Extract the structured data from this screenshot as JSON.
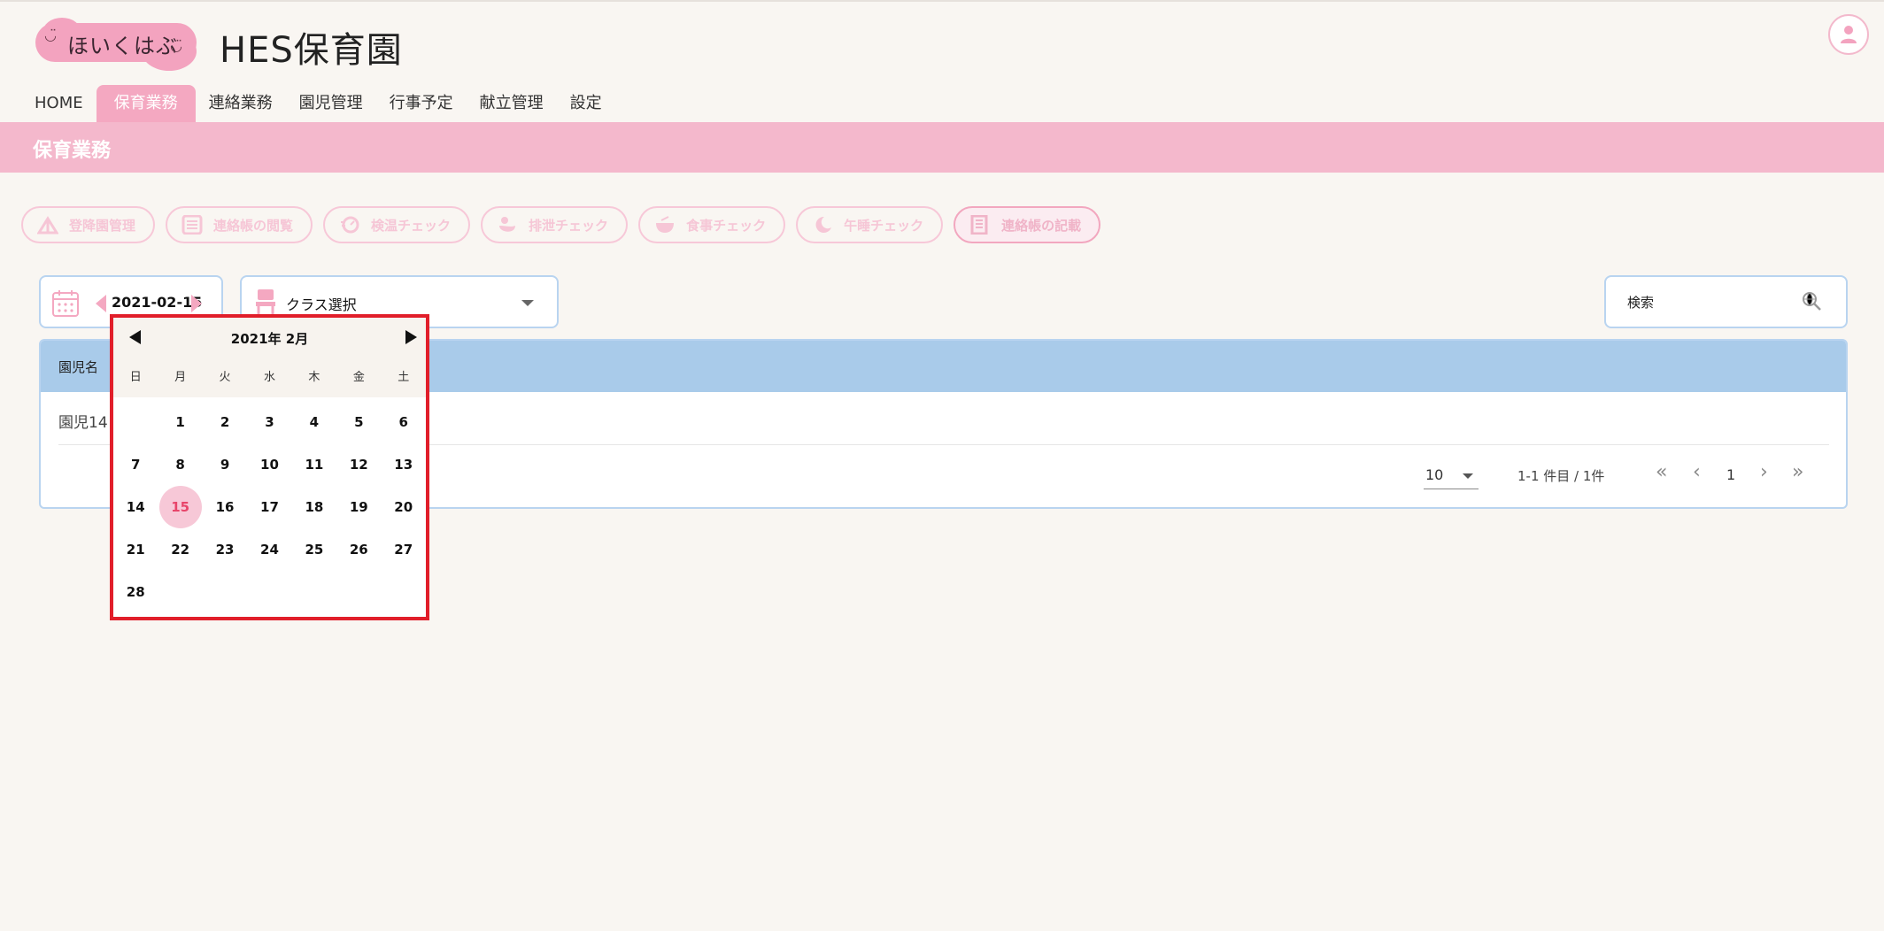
{
  "logo": {
    "text": "ほいくはぶ",
    "smile_left": "◡̈",
    "smile_right": "◡̈"
  },
  "site_title": "HES保育園",
  "nav": [
    {
      "label": "HOME",
      "active": false
    },
    {
      "label": "保育業務",
      "active": true
    },
    {
      "label": "連絡業務",
      "active": false
    },
    {
      "label": "園児管理",
      "active": false
    },
    {
      "label": "行事予定",
      "active": false
    },
    {
      "label": "献立管理",
      "active": false
    },
    {
      "label": "設定",
      "active": false
    }
  ],
  "section_title": "保育業務",
  "actions": [
    {
      "label": "登降園管理",
      "icon": "gate-icon"
    },
    {
      "label": "連絡帳の閲覧",
      "icon": "list-icon"
    },
    {
      "label": "検温チェック",
      "icon": "thermometer-icon"
    },
    {
      "label": "排泄チェック",
      "icon": "duck-icon"
    },
    {
      "label": "食事チェック",
      "icon": "bowl-icon"
    },
    {
      "label": "午睡チェック",
      "icon": "moon-icon"
    },
    {
      "label": "連絡帳の記載",
      "icon": "notebook-icon"
    }
  ],
  "filters": {
    "date": "2021-02-15",
    "class_placeholder": "クラス選択",
    "search_placeholder": "検索"
  },
  "table": {
    "header": "園児名",
    "rows": [
      "園児14"
    ]
  },
  "pagination": {
    "per_page": "10",
    "range": "1-1 件目 / 1件",
    "page": "1",
    "first": "«",
    "prev": "‹",
    "next": "›",
    "last": "»"
  },
  "picker": {
    "month_label": "2021年 2月",
    "weekdays": [
      "日",
      "月",
      "火",
      "水",
      "木",
      "金",
      "土"
    ],
    "weeks": [
      [
        "",
        "1",
        "2",
        "3",
        "4",
        "5",
        "6"
      ],
      [
        "7",
        "8",
        "9",
        "10",
        "11",
        "12",
        "13"
      ],
      [
        "14",
        "15",
        "16",
        "17",
        "18",
        "19",
        "20"
      ],
      [
        "21",
        "22",
        "23",
        "24",
        "25",
        "26",
        "27"
      ],
      [
        "28",
        "",
        "",
        "",
        "",
        "",
        ""
      ]
    ],
    "selected_day": "15"
  },
  "colors": {
    "accent_pink": "#f4a8c1",
    "band_pink": "#f4b8cc",
    "header_blue": "#a9cbea",
    "highlight_red": "#e11e2a"
  }
}
